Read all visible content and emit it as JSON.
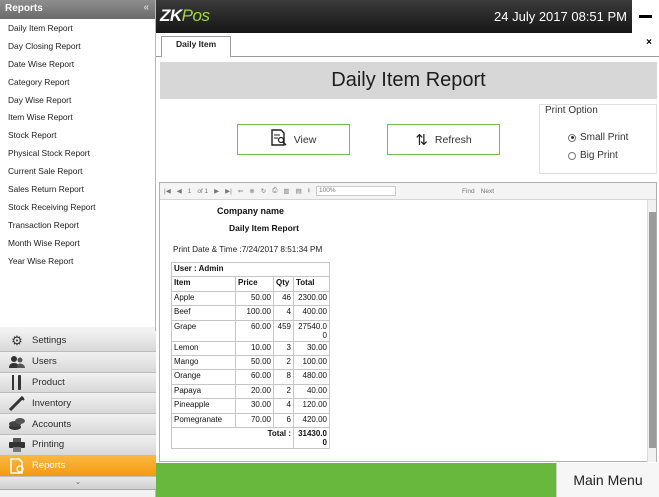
{
  "sidebar": {
    "header": "Reports",
    "collapse_glyph": "«",
    "reports": [
      "Daily Item Report",
      "Day Closing Report",
      "Date Wise Report",
      "Category Report",
      "Day Wise Report",
      "Item Wise Report",
      "Stock Report",
      "Physical Stock Report",
      "Current Sale Report",
      "Sales Return Report",
      "Stock Receiving Report",
      "Transaction Report",
      "Month Wise Report",
      "Year Wise Report"
    ],
    "nav": [
      {
        "label": "Settings",
        "icon": "gear-icon"
      },
      {
        "label": "Users",
        "icon": "users-icon"
      },
      {
        "label": "Product",
        "icon": "product-icon"
      },
      {
        "label": "Inventory",
        "icon": "inventory-icon"
      },
      {
        "label": "Accounts",
        "icon": "accounts-icon"
      },
      {
        "label": "Printing",
        "icon": "printer-icon"
      },
      {
        "label": "Reports",
        "icon": "reports-icon",
        "active": true
      }
    ]
  },
  "topbar": {
    "logo_zk": "ZK",
    "logo_pos": "Pos",
    "datetime": "24 July 2017 08:51 PM"
  },
  "tab": {
    "label": "Daily Item",
    "close": "×"
  },
  "page_title": "Daily Item Report",
  "actions": {
    "view": "View",
    "refresh": "Refresh"
  },
  "print_option": {
    "title": "Print Option",
    "options": [
      {
        "label": "Small Print",
        "selected": true
      },
      {
        "label": "Big Print",
        "selected": false
      }
    ]
  },
  "viewer": {
    "page_of": "of 1",
    "page": "1",
    "zoom": "100%",
    "find": "Find",
    "next": "Next"
  },
  "report": {
    "company": "Company name",
    "title": "Daily Item Report",
    "print_date": "Print Date & Time :7/24/2017 8:51:34 PM",
    "user": "User : Admin",
    "columns": [
      "Item",
      "Price",
      "Qty",
      "Total"
    ],
    "rows": [
      [
        "Apple",
        "50.00",
        "46",
        "2300.00"
      ],
      [
        "Beef",
        "100.00",
        "4",
        "400.00"
      ],
      [
        "Grape",
        "60.00",
        "459",
        "27540.0\n0"
      ],
      [
        "Lemon",
        "10.00",
        "3",
        "30.00"
      ],
      [
        "Mango",
        "50.00",
        "2",
        "100.00"
      ],
      [
        "Orange",
        "60.00",
        "8",
        "480.00"
      ],
      [
        "Papaya",
        "20.00",
        "2",
        "40.00"
      ],
      [
        "Pineapple",
        "30.00",
        "4",
        "120.00"
      ],
      [
        "Pomegranate",
        "70.00",
        "6",
        "420.00"
      ]
    ],
    "total_label": "Total :",
    "total_value": "31430.0\n0"
  },
  "bottom": {
    "main_menu": "Main Menu"
  },
  "colors": {
    "accent_green": "#68b83e",
    "active_orange": "#f39a13",
    "topbar": "#1f1f1f"
  }
}
